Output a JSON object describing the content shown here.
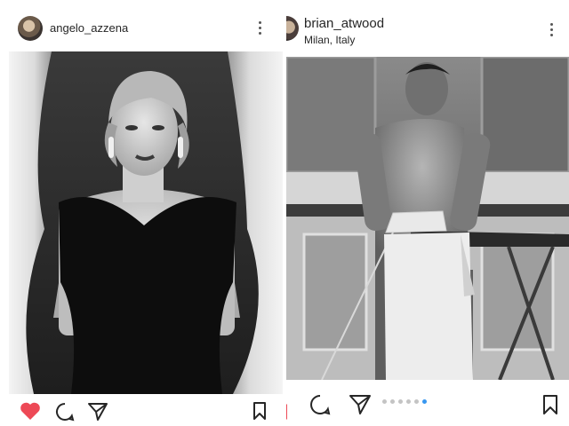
{
  "left_post": {
    "username": "angelo_azzena",
    "avatar_icon": "profile-avatar",
    "more_icon": "more-vertical-icon",
    "liked": true,
    "like_color": "#ed4956",
    "actions": [
      "heart-icon",
      "comment-icon",
      "share-icon",
      "bookmark-icon"
    ]
  },
  "right_post": {
    "username": "brian_atwood",
    "location": "Milan, Italy",
    "avatar_icon": "profile-avatar",
    "more_icon": "more-vertical-icon",
    "actions": [
      "comment-icon",
      "share-icon",
      "bookmark-icon"
    ],
    "carousel": {
      "count": 6,
      "active_index": 5,
      "active_color": "#3897f0"
    }
  }
}
